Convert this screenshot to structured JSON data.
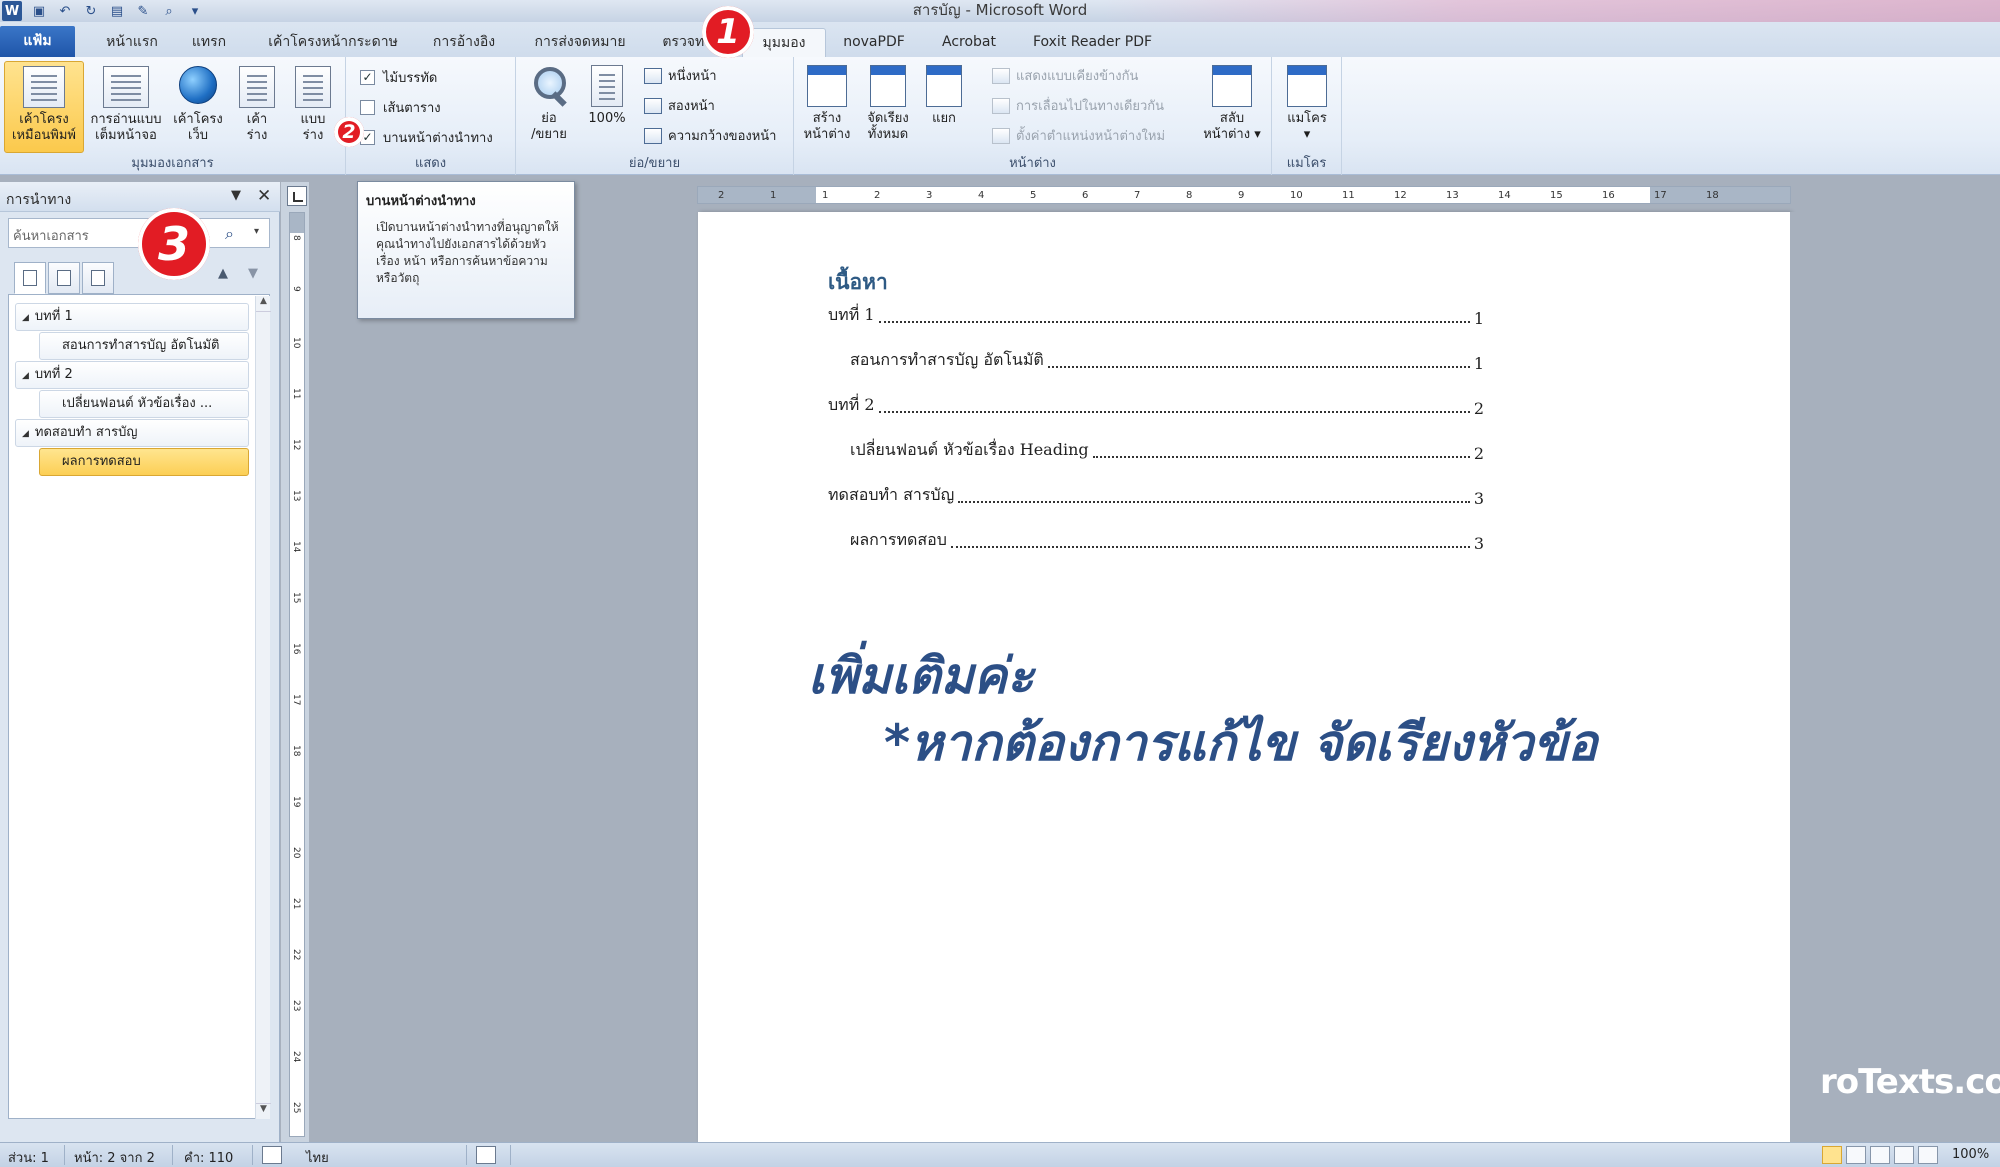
{
  "window": {
    "title": "สารบัญ  -  Microsoft Word",
    "app_icon": "W"
  },
  "qat": {
    "icons": [
      "save-icon",
      "undo-icon",
      "redo-icon",
      "print-icon",
      "customize-icon"
    ]
  },
  "tabs": [
    {
      "id": "file",
      "label": "แฟ้ม"
    },
    {
      "id": "home",
      "label": "หน้าแรก"
    },
    {
      "id": "insert",
      "label": "แทรก"
    },
    {
      "id": "pagelayout",
      "label": "เค้าโครงหน้ากระดาษ"
    },
    {
      "id": "references",
      "label": "การอ้างอิง"
    },
    {
      "id": "mailings",
      "label": "การส่งจดหมาย"
    },
    {
      "id": "review",
      "label": "ตรวจทาน"
    },
    {
      "id": "view",
      "label": "มุมมอง"
    },
    {
      "id": "novapdf",
      "label": "novaPDF"
    },
    {
      "id": "acrobat",
      "label": "Acrobat"
    },
    {
      "id": "foxit",
      "label": "Foxit Reader PDF"
    }
  ],
  "ribbon": {
    "doc_views": {
      "label": "มุมมองเอกสาร",
      "buttons": [
        {
          "line1": "เค้าโครง",
          "line2": "เหมือนพิมพ์"
        },
        {
          "line1": "การอ่านแบบ",
          "line2": "เต็มหน้าจอ"
        },
        {
          "line1": "เค้าโครง",
          "line2": "เว็บ"
        },
        {
          "line1": "เค้า",
          "line2": "ร่าง"
        },
        {
          "line1": "แบบ",
          "line2": "ร่าง"
        }
      ]
    },
    "show": {
      "label": "แสดง",
      "ruler": "ไม้บรรทัด",
      "gridlines": "เส้นตาราง",
      "navpane": "บานหน้าต่างนำทาง",
      "ruler_checked": "✓",
      "navpane_checked": "✓"
    },
    "zoom": {
      "label": "ย่อ/ขยาย",
      "zoom_line1": "ย่อ",
      "zoom_line2": "/ขยาย",
      "hundred": "100%",
      "one_page": "หนึ่งหน้า",
      "two_pages": "สองหน้า",
      "page_width": "ความกว้างของหน้า"
    },
    "window": {
      "label": "หน้าต่าง",
      "new_line1": "สร้าง",
      "new_line2": "หน้าต่าง",
      "arrange_line1": "จัดเรียง",
      "arrange_line2": "ทั้งหมด",
      "split": "แยก",
      "side_by_side": "แสดงแบบเคียงข้างกัน",
      "sync_scroll": "การเลื่อนไปในทางเดียวกัน",
      "reset_pos": "ตั้งค่าตำแหน่งหน้าต่างใหม่",
      "switch_line1": "สลับ",
      "switch_line2": "หน้าต่าง ▾"
    },
    "macros": {
      "label": "แมโคร",
      "btn": "แมโคร",
      "arrow": "▾"
    }
  },
  "badges": {
    "b1": "1",
    "b2": "2",
    "b3": "3"
  },
  "tooltip": {
    "title": "บานหน้าต่างนำทาง",
    "body": "เปิดบานหน้าต่างนำทางที่อนุญาตให้คุณนำทางไปยังเอกสารได้ด้วยหัวเรื่อง หน้า หรือการค้นหาข้อความหรือวัตถุ"
  },
  "navpane": {
    "title": "การนำทาง",
    "dropdown": "▼",
    "close": "✕",
    "search_placeholder": "ค้นหาเอกสาร",
    "search_icon": "⌕",
    "search_dd": "▾",
    "up": "▲",
    "down": "▼",
    "items": [
      {
        "text": "บทที่ 1",
        "level": 1
      },
      {
        "text": "สอนการทำสารบัญ อัตโนมัติ",
        "level": 2
      },
      {
        "text": "บทที่ 2",
        "level": 1
      },
      {
        "text": "เปลี่ยนฟอนต์ หัวข้อเรื่อง ...",
        "level": 2
      },
      {
        "text": "ทดสอบทำ สารบัญ",
        "level": 1
      },
      {
        "text": "ผลการทดสอบ",
        "level": 2,
        "selected": true
      }
    ]
  },
  "ruler": {
    "h_ticks": [
      "2",
      "1",
      "1",
      "2",
      "3",
      "4",
      "5",
      "6",
      "7",
      "8",
      "9",
      "10",
      "11",
      "12",
      "13",
      "14",
      "15",
      "16",
      "17",
      "18"
    ],
    "v_ticks": [
      "8",
      "9",
      "10",
      "11",
      "12",
      "13",
      "14",
      "15",
      "16",
      "17",
      "18",
      "19",
      "20",
      "21",
      "22",
      "23",
      "24",
      "25"
    ]
  },
  "document": {
    "toc_heading": "เนื้อหา",
    "toc": [
      {
        "text": "บทที่ 1",
        "page": "1",
        "level": 1
      },
      {
        "text": "สอนการทำสารบัญ อัตโนมัติ",
        "page": "1",
        "level": 2
      },
      {
        "text": "บทที่ 2",
        "page": "2",
        "level": 1
      },
      {
        "text": "เปลี่ยนฟอนต์ หัวข้อเรื่อง Heading",
        "page": "2",
        "level": 2
      },
      {
        "text": "ทดสอบทำ สารบัญ",
        "page": "3",
        "level": 1
      },
      {
        "text": "ผลการทดสอบ",
        "page": "3",
        "level": 2
      }
    ],
    "note_line1": "เพิ่มเติมค่ะ",
    "note_line2": "*หากต้องการแก้ไข จัดเรียงหัวข้อ"
  },
  "watermark": "roTexts.com",
  "statusbar": {
    "section": "ส่วน: 1",
    "page": "หน้า: 2 จาก 2",
    "words": "คำ: 110",
    "language": "ไทย",
    "zoom": "100%"
  },
  "colors": {
    "accent": "#2b5797",
    "note": "#2c4f86",
    "badge": "#e21c24",
    "selected": "#fccf55"
  }
}
